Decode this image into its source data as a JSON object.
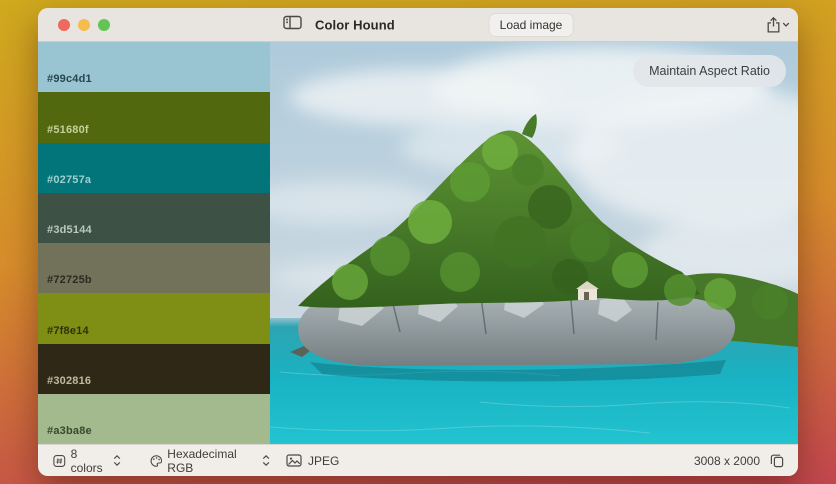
{
  "window": {
    "title": "Color Hound",
    "load_image_label": "Load image",
    "maintain_aspect_ratio_label": "Maintain Aspect Ratio"
  },
  "palette": {
    "swatches": [
      {
        "hex": "#99c4d1",
        "label_color": "#274750"
      },
      {
        "hex": "#51680f",
        "label_color": "#c6d19c"
      },
      {
        "hex": "#02757a",
        "label_color": "#9fd0cf"
      },
      {
        "hex": "#3d5144",
        "label_color": "#bcc8bf"
      },
      {
        "hex": "#72725b",
        "label_color": "#2b2b20"
      },
      {
        "hex": "#7f8e14",
        "label_color": "#2d3306"
      },
      {
        "hex": "#302816",
        "label_color": "#c0b89f"
      },
      {
        "hex": "#a3ba8e",
        "label_color": "#39482c"
      }
    ]
  },
  "footer": {
    "count_label": "8 colors",
    "format_label": "Hexadecimal RGB",
    "file_type": "JPEG",
    "image_size": "3008 x 2000"
  },
  "icons": {
    "titlebar": [
      "sidebar-toggle-icon",
      "share-icon",
      "chevron-down-icon"
    ],
    "footer": [
      "number-square-icon",
      "stepper-icon",
      "palette-icon",
      "photo-icon",
      "copy-icon"
    ]
  },
  "colors": {
    "bg_top": "#cfa91e",
    "bg_mid": "#d68c2b",
    "bg_bottom": "#c2464e",
    "titlebar_bg": "#e8e4e0",
    "footer_bg": "#f1ede9",
    "traffic_red": "#ee6a5f",
    "traffic_yellow": "#f5bd4f",
    "traffic_green": "#61c454",
    "text_dark": "#2b2926"
  }
}
